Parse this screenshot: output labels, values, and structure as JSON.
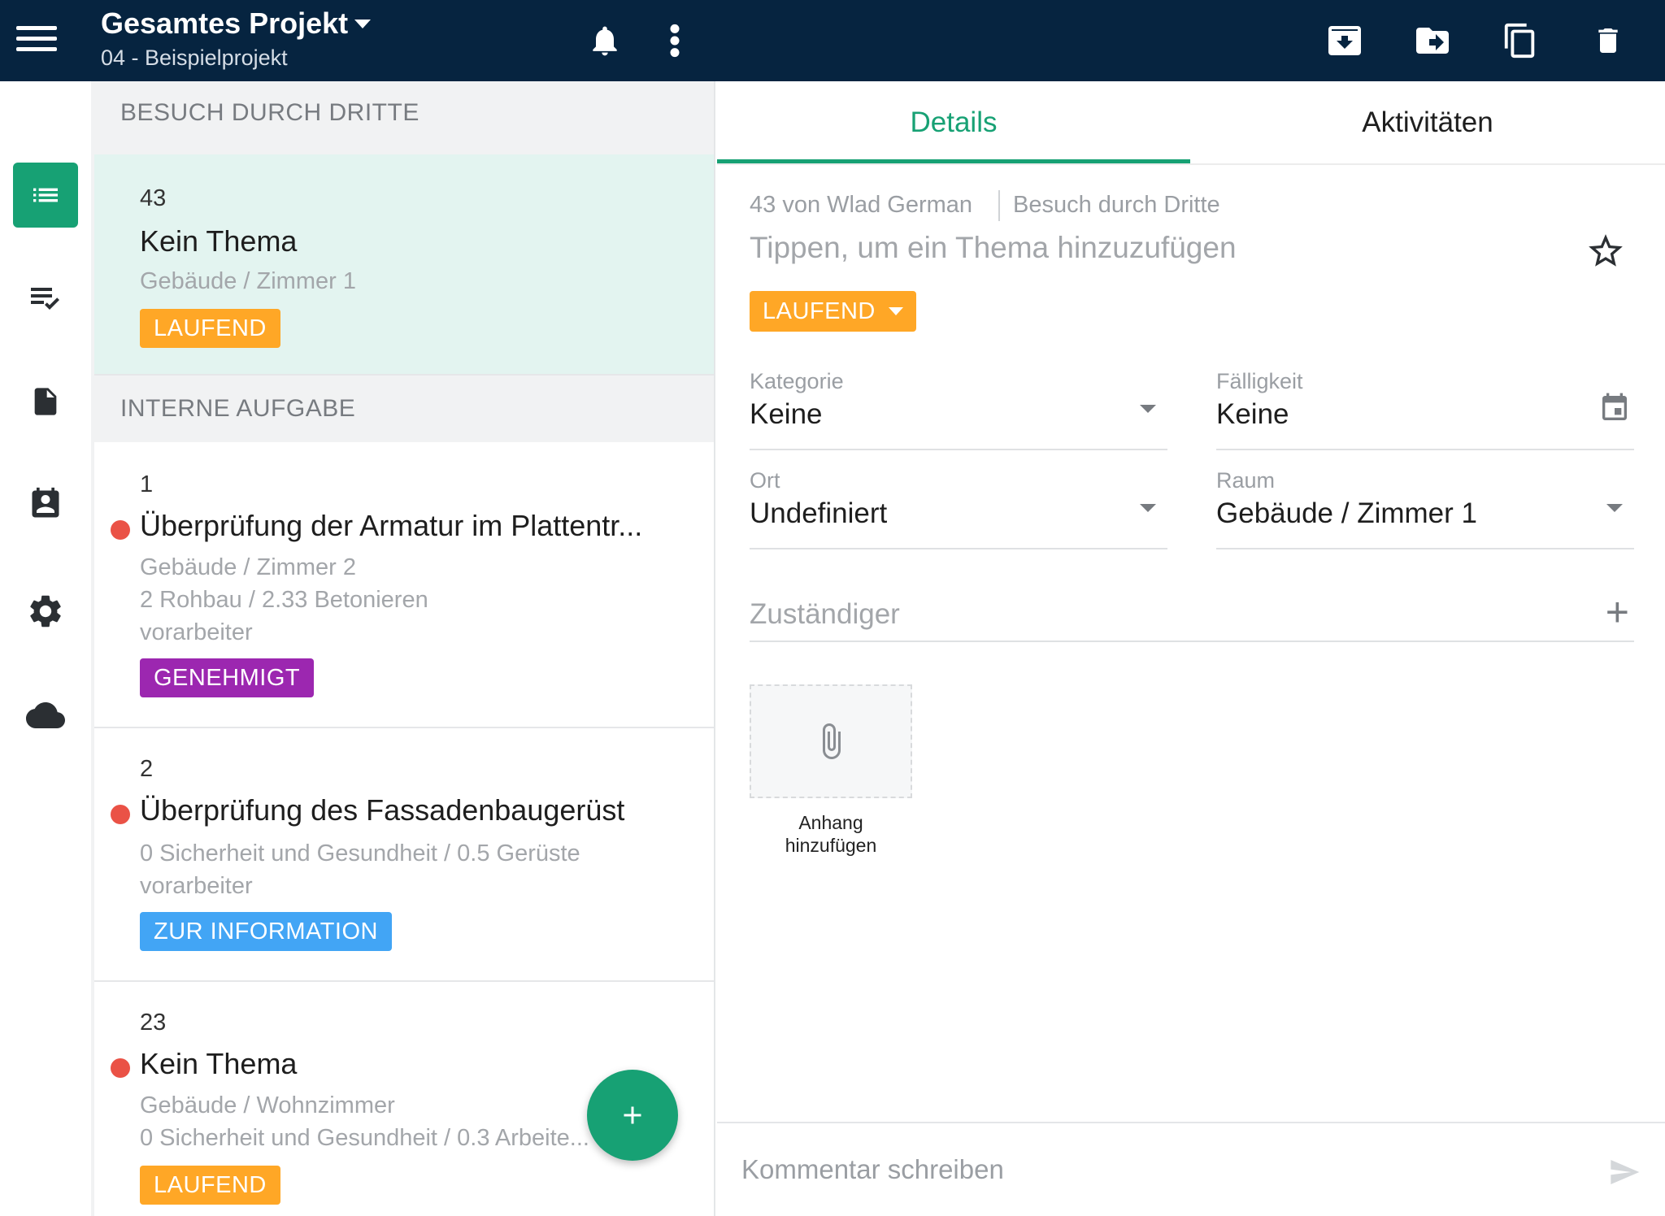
{
  "header": {
    "project_title": "Gesamtes Projekt",
    "project_subtitle": "04 - Beispielprojekt",
    "icons": [
      "menu-icon",
      "bell-icon",
      "more-vert-icon",
      "archive-icon",
      "move-to-folder-icon",
      "copy-icon",
      "delete-icon"
    ]
  },
  "rail": {
    "items": [
      "list-icon",
      "checklist-icon",
      "document-icon",
      "contacts-icon",
      "settings-icon",
      "cloud-icon"
    ],
    "active": "list-icon"
  },
  "list": {
    "section1": "BESUCH DURCH DRITTE",
    "section2": "INTERNE AUFGABE",
    "cards": [
      {
        "num": "43",
        "title": "Kein Thema",
        "meta1": "Gebäude / Zimmer 1",
        "badge": "LAUFEND"
      },
      {
        "num": "1",
        "title": "Überprüfung der Armatur im Plattentr...",
        "meta1": "Gebäude / Zimmer 2",
        "meta2": "2 Rohbau / 2.33 Betonieren",
        "meta3": "vorarbeiter",
        "badge": "GENEHMIGT"
      },
      {
        "num": "2",
        "title": "Überprüfung des Fassadenbaugerüst",
        "meta1": "0 Sicherheit und Gesundheit / 0.5 Gerüste",
        "meta2": "vorarbeiter",
        "badge": "ZUR INFORMATION"
      },
      {
        "num": "23",
        "title": "Kein Thema",
        "meta1": "Gebäude / Wohnzimmer",
        "meta2": "0 Sicherheit und Gesundheit / 0.3 Arbeite...",
        "badge": "LAUFEND"
      }
    ],
    "fab_symbol": "+"
  },
  "detail": {
    "tabs": {
      "details": "Details",
      "activities": "Aktivitäten"
    },
    "breadcrumb_author": "43 von Wlad German",
    "breadcrumb_type": "Besuch durch Dritte",
    "topic_placeholder": "Tippen, um ein Thema hinzuzufügen",
    "status": "LAUFEND",
    "category_label": "Kategorie",
    "category_value": "Keine",
    "due_label": "Fälligkeit",
    "due_value": "Keine",
    "location_label": "Ort",
    "location_value": "Undefiniert",
    "room_label": "Raum",
    "room_value": "Gebäude / Zimmer 1",
    "assignee_label": "Zuständiger",
    "attach_label_1": "Anhang",
    "attach_label_2": "hinzufügen",
    "comment_placeholder": "Kommentar schreiben"
  },
  "colors": {
    "header_bg": "#062440",
    "accent_green": "#17a174",
    "status_orange": "#ffa726",
    "status_purple": "#9c27b0",
    "status_blue": "#42a5f5",
    "priority_red": "#ea5246"
  }
}
